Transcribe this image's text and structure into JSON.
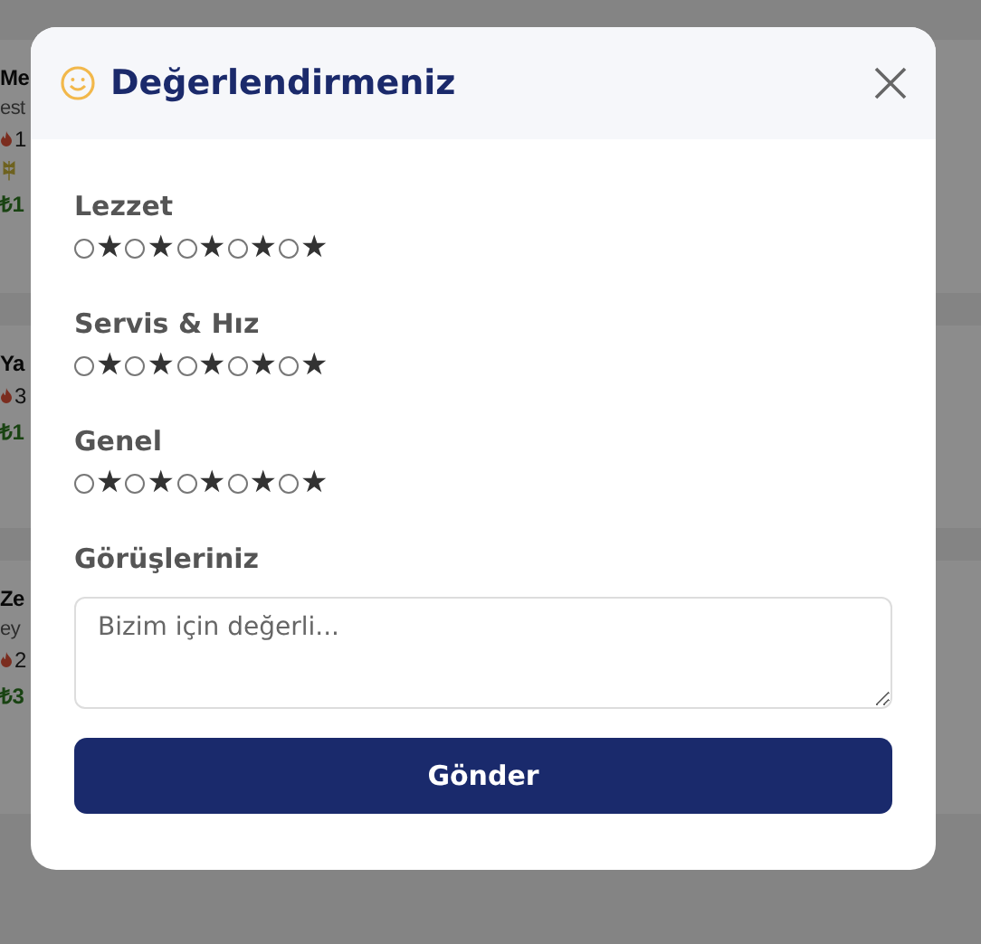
{
  "background_cards": [
    {
      "title": "Me",
      "subtitle": "est",
      "flame_value": "1",
      "leaf": true,
      "price": "₺1"
    },
    {
      "title": "Ya",
      "flame_value": "3",
      "leaf": false,
      "price": "₺1"
    },
    {
      "title": "Ze",
      "subtitle": "ey",
      "flame_value": "2",
      "leaf": false,
      "price": "₺3"
    }
  ],
  "modal": {
    "title": "Değerlendirmeniz",
    "ratings": [
      {
        "label": "Lezzet",
        "options": [
          {
            "label": "★",
            "selected": false
          },
          {
            "label": "★",
            "selected": false
          },
          {
            "label": "★",
            "selected": false
          },
          {
            "label": "★",
            "selected": false
          },
          {
            "label": "★",
            "selected": false
          }
        ]
      },
      {
        "label": "Servis & Hız",
        "options": [
          {
            "label": "★",
            "selected": false
          },
          {
            "label": "★",
            "selected": false
          },
          {
            "label": "★",
            "selected": false
          },
          {
            "label": "★",
            "selected": false
          },
          {
            "label": "★",
            "selected": false
          }
        ]
      },
      {
        "label": "Genel",
        "options": [
          {
            "label": "★",
            "selected": false
          },
          {
            "label": "★",
            "selected": false
          },
          {
            "label": "★",
            "selected": false
          },
          {
            "label": "★",
            "selected": false
          },
          {
            "label": "★",
            "selected": false
          }
        ]
      }
    ],
    "comment": {
      "label": "Görüşleriniz",
      "placeholder": "Bizim için değerli..."
    },
    "submit": "Gönder"
  }
}
